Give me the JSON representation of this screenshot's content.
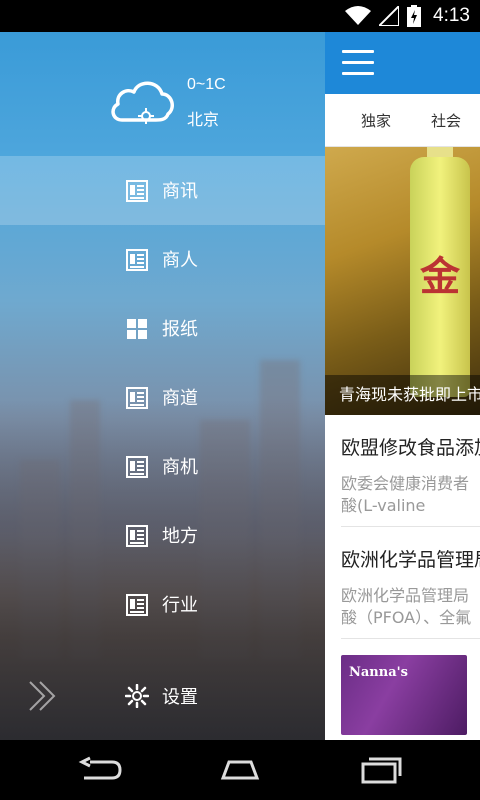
{
  "status_bar": {
    "time": "4:13"
  },
  "drawer": {
    "weather": {
      "temp": "0~1C",
      "city": "北京"
    },
    "menu": [
      {
        "label": "商讯",
        "icon": "news-icon",
        "active": true
      },
      {
        "label": "商人",
        "icon": "news-icon",
        "active": false
      },
      {
        "label": "报纸",
        "icon": "grid-icon",
        "active": false
      },
      {
        "label": "商道",
        "icon": "news-icon",
        "active": false
      },
      {
        "label": "商机",
        "icon": "news-icon",
        "active": false
      },
      {
        "label": "地方",
        "icon": "news-icon",
        "active": false
      },
      {
        "label": "行业",
        "icon": "news-icon",
        "active": false
      }
    ],
    "settings_label": "设置"
  },
  "content": {
    "tabs": [
      "独家",
      "社会"
    ],
    "hero_caption": "青海现未获批即上市",
    "articles": [
      {
        "title": "欧盟修改食品添加",
        "summary_lines": [
          "欧委会健康消费者",
          "酸(L-valine"
        ]
      },
      {
        "title": "欧洲化学品管理局",
        "summary_lines": [
          "欧洲化学品管理局",
          "酸（PFOA）、全氟"
        ]
      }
    ],
    "thumb_text": "Nanna's"
  },
  "colors": {
    "appbar": "#1e88d8",
    "drawer_top": "#3a9bd8"
  }
}
